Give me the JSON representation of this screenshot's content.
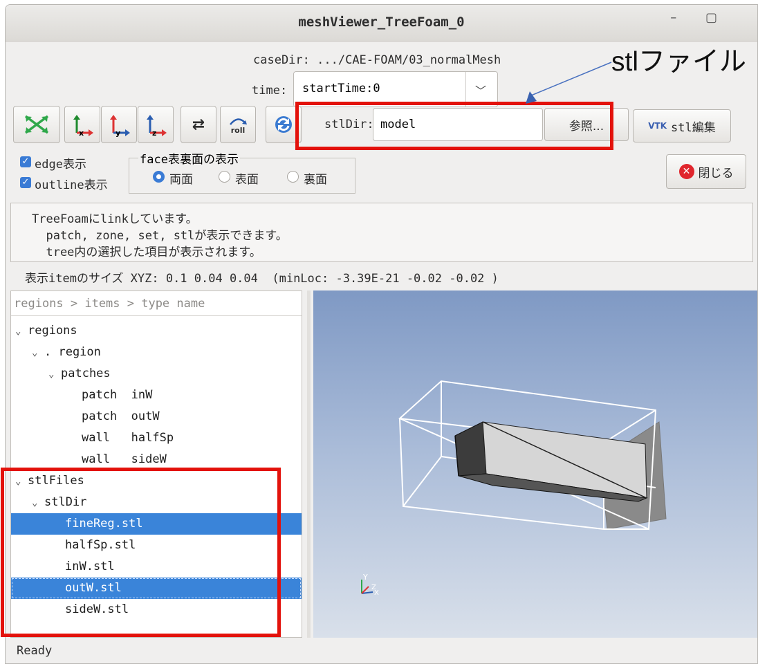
{
  "window": {
    "title": "meshViewer_TreeFoam_0"
  },
  "header": {
    "case_dir_label": "caseDir:",
    "case_dir_value": ".../CAE-FOAM/03_normalMesh",
    "time_label": "time:",
    "time_value": "startTime:0"
  },
  "toolbar": {
    "fit_icon": "fit-view-icon",
    "axis_x_label": "x",
    "axis_y_label": "y",
    "axis_z_label": "z",
    "roll_label": "roll",
    "stl_dir_label": "stlDir:",
    "stl_dir_value": "model",
    "browse_label": "参照...",
    "stl_edit_label": "stl編集",
    "close_label": "閉じる"
  },
  "options": {
    "edge_label": "edge表示",
    "outline_label": "outline表示",
    "edge_checked": true,
    "outline_checked": true,
    "face_group_title": "face表裏面の表示",
    "face_both": "両面",
    "face_front": "表面",
    "face_back": "裏面",
    "face_selected": "両面"
  },
  "info": {
    "lines": [
      "TreeFoamにlinkしています。",
      "  patch, zone, set, stlが表示できます。",
      "  tree内の選択した項目が表示されます。"
    ]
  },
  "size_line": "表示itemのサイズ XYZ: 0.1 0.04 0.04  (minLoc: -3.39E-21 -0.02 -0.02 )",
  "tree": {
    "header": "regions > items > type name",
    "rows": [
      {
        "text": "regions",
        "indent": 0,
        "chevron": true,
        "selected": false
      },
      {
        "text": ". region",
        "indent": 1,
        "chevron": true,
        "selected": false
      },
      {
        "text": "patches",
        "indent": 2,
        "chevron": true,
        "selected": false
      },
      {
        "text": "patch  inW",
        "indent": 4,
        "chevron": false,
        "selected": false
      },
      {
        "text": "patch  outW",
        "indent": 4,
        "chevron": false,
        "selected": false
      },
      {
        "text": "wall   halfSp",
        "indent": 4,
        "chevron": false,
        "selected": false
      },
      {
        "text": "wall   sideW",
        "indent": 4,
        "chevron": false,
        "selected": false
      },
      {
        "text": "stlFiles",
        "indent": 0,
        "chevron": true,
        "selected": false
      },
      {
        "text": "stlDir",
        "indent": 1,
        "chevron": true,
        "selected": false
      },
      {
        "text": "fineReg.stl",
        "indent": 3,
        "chevron": false,
        "selected": true
      },
      {
        "text": "halfSp.stl",
        "indent": 3,
        "chevron": false,
        "selected": false
      },
      {
        "text": "inW.stl",
        "indent": 3,
        "chevron": false,
        "selected": false
      },
      {
        "text": "outW.stl",
        "indent": 3,
        "chevron": false,
        "selected": true
      },
      {
        "text": "sideW.stl",
        "indent": 3,
        "chevron": false,
        "selected": false
      }
    ]
  },
  "status": "Ready",
  "annotation": {
    "text": "stlファイル"
  },
  "colors": {
    "accent": "#3a84d9",
    "highlight_box": "#e3120b",
    "viewport_top": "#7f99c4"
  }
}
